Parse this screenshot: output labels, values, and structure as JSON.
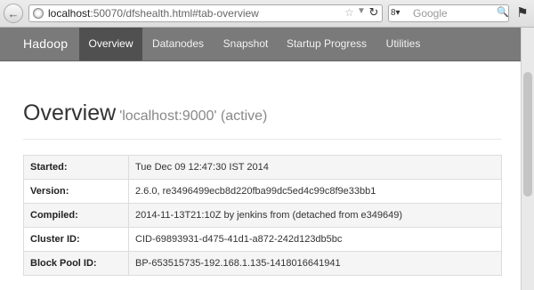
{
  "browser": {
    "url_host": "localhost",
    "url_rest": ":50070/dfshealth.html#tab-overview",
    "search_placeholder": "Google",
    "back_icon": "back-arrow-icon",
    "reload_icon": "reload-icon"
  },
  "navbar": {
    "brand": "Hadoop",
    "items": [
      {
        "label": "Overview",
        "active": true
      },
      {
        "label": "Datanodes"
      },
      {
        "label": "Snapshot"
      },
      {
        "label": "Startup Progress"
      },
      {
        "label": "Utilities"
      }
    ]
  },
  "page": {
    "title": "Overview",
    "subtitle": "'localhost:9000' (active)"
  },
  "info_table": [
    {
      "key": "Started:",
      "value": "Tue Dec 09 12:47:30 IST 2014"
    },
    {
      "key": "Version:",
      "value": "2.6.0, re3496499ecb8d220fba99dc5ed4c99c8f9e33bb1"
    },
    {
      "key": "Compiled:",
      "value": "2014-11-13T21:10Z by jenkins from (detached from e349649)"
    },
    {
      "key": "Cluster ID:",
      "value": "CID-69893931-d475-41d1-a872-242d123db5bc"
    },
    {
      "key": "Block Pool ID:",
      "value": "BP-653515735-192.168.1.135-1418016641941"
    }
  ],
  "colors": {
    "navbar_bg": "#7a7a7a",
    "navbar_active_bg": "#505050",
    "table_stripe": "#f5f5f5"
  }
}
